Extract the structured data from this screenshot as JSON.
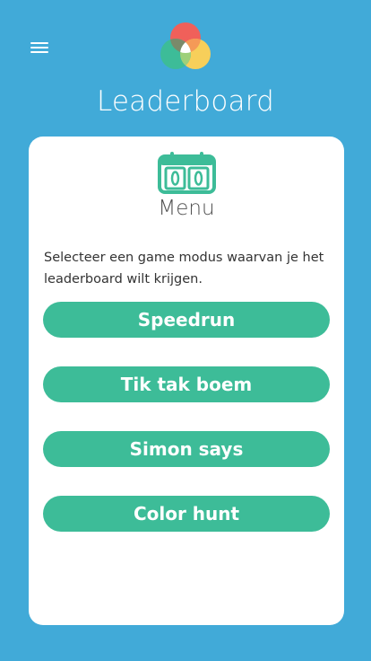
{
  "header": {
    "title": "Leaderboard",
    "menu_icon": "hamburger-menu-icon",
    "logo_icon": "color-circles-logo"
  },
  "card": {
    "icon": "scoreboard-icon",
    "title": "Menu",
    "description": "Selecteer een game modus waarvan je het leaderboard wilt krijgen.",
    "buttons": [
      {
        "label": "Speedrun"
      },
      {
        "label": "Tik tak boem"
      },
      {
        "label": "Simon says"
      },
      {
        "label": "Color hunt"
      }
    ]
  },
  "colors": {
    "background": "#41aad8",
    "card": "#ffffff",
    "button": "#3dbc98",
    "logo_red": "#f0605a",
    "logo_green": "#3dbc98",
    "logo_yellow": "#f7cf5a"
  }
}
